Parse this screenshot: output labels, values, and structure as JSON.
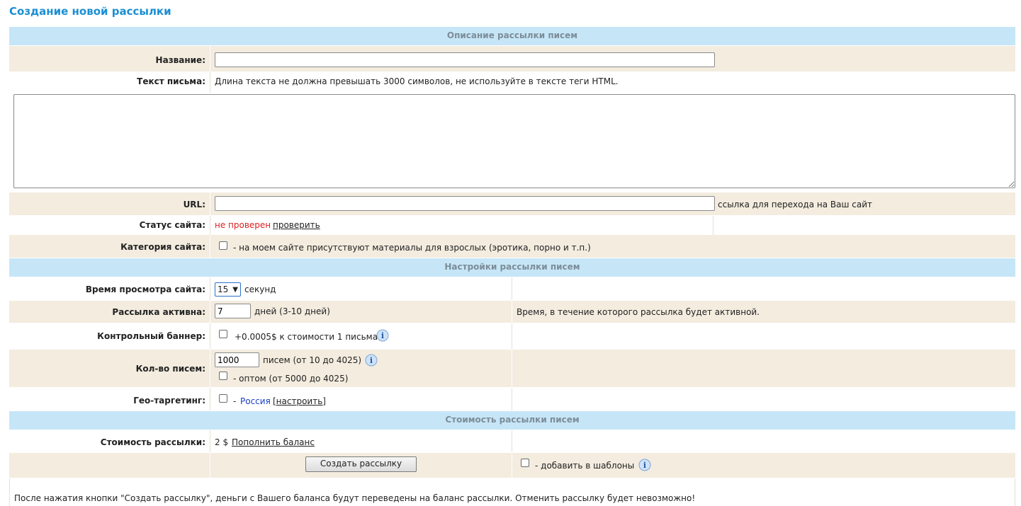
{
  "page_title": "Создание новой рассылки",
  "sections": {
    "description": "Описание рассылки писем",
    "settings": "Настройки рассылки писем",
    "cost": "Стоимость рассылки писем"
  },
  "name": {
    "label": "Название:",
    "value": ""
  },
  "letter": {
    "label": "Текст письма:",
    "hint": "Длина текста не должна превышать 3000 символов, не используйте в тексте теги HTML.",
    "value": ""
  },
  "url": {
    "label": "URL:",
    "value": "",
    "hint": "ссылка для перехода на Ваш сайт"
  },
  "site_status": {
    "label": "Статус сайта:",
    "status": "не проверен",
    "check_link": "проверить"
  },
  "site_category": {
    "label": "Категория сайта:",
    "checkbox_text": "- на моем сайте присутствуют материалы для взрослых (эротика, порно и т.п.)",
    "checked": false
  },
  "view_time": {
    "label": "Время просмотра сайта:",
    "selected": "15",
    "unit": "секунд"
  },
  "active": {
    "label": "Рассылка активна:",
    "value": "7",
    "unit": "дней (3-10 дней)",
    "note": "Время, в течение которого рассылка будет активной."
  },
  "banner": {
    "label": "Контрольный баннер:",
    "text": "+0.0005$ к стоимости 1 письма",
    "checked": false
  },
  "count": {
    "label": "Кол-во писем:",
    "value": "1000",
    "unit": "писем (от 10 до 4025)",
    "wholesale_text": "- оптом (от 5000 до 4025)",
    "wholesale_checked": false
  },
  "geo": {
    "label": "Гео-таргетинг:",
    "dash": "-",
    "country": "Россия",
    "configure": "[настроить]",
    "checked": false
  },
  "cost": {
    "label": "Стоимость рассылки:",
    "value": "2 $",
    "topup_link": "Пополнить баланс"
  },
  "submit": {
    "button_label": "Создать рассылку",
    "template_text": "- добавить в шаблоны",
    "template_checked": false
  },
  "footer_note": "После нажатия кнопки \"Создать рассылку\", деньги с Вашего баланса будут переведены на баланс рассылки. Отменить рассылку будет невозможно!",
  "colors": {
    "header_bg": "#c6e6f8",
    "row_beige": "#f3ecdf",
    "title": "#1a8fd4",
    "status_red": "#e02020",
    "link_blue": "#1a3fc6"
  }
}
